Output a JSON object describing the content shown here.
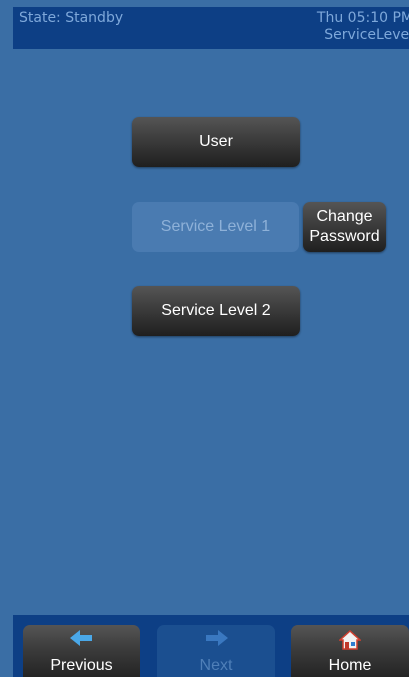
{
  "status": {
    "state_text": "State: Standby",
    "datetime_text": "Thu 05:10 PM",
    "level_text": "ServiceLevel"
  },
  "menu": {
    "user_label": "User",
    "service_level_1_label": "Service Level 1",
    "change_password_line1": "Change",
    "change_password_line2": "Password",
    "service_level_2_label": "Service Level 2"
  },
  "nav": {
    "previous_label": "Previous",
    "next_label": "Next",
    "home_label": "Home",
    "previous_icon": "arrow-left-icon",
    "next_icon": "arrow-right-icon",
    "home_icon": "home-icon"
  },
  "colors": {
    "background": "#3a6ea5",
    "bar": "#0d3f85",
    "status_text": "#7ea8da",
    "button_dark": "#3c3c3c",
    "disabled_button": "#4a7bb1"
  }
}
